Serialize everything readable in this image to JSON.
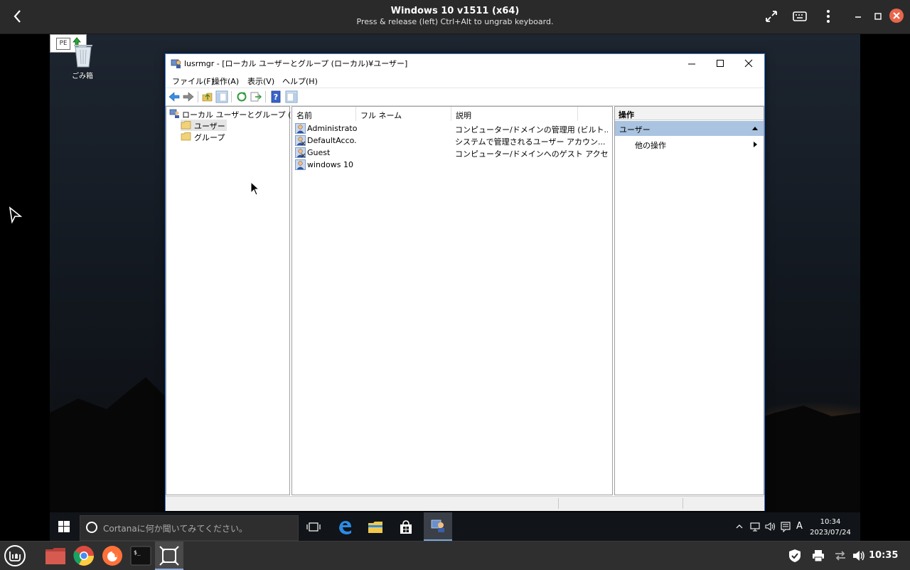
{
  "viewer": {
    "title": "Windows 10 v1511 (x64)",
    "subtitle": "Press & release (left) Ctrl+Alt to ungrab keyboard."
  },
  "desktop": {
    "recycle_bin_label": "ごみ箱",
    "ime_label": "PE"
  },
  "window": {
    "title": "lusrmgr - [ローカル ユーザーとグループ (ローカル)¥ユーザー]",
    "menu": [
      "ファイル(F)",
      "操作(A)",
      "表示(V)",
      "ヘルプ(H)"
    ],
    "tree": {
      "root": "ローカル ユーザーとグループ (ローカル)",
      "children": [
        "ユーザー",
        "グループ"
      ],
      "selected": "ユーザー"
    },
    "columns": [
      "名前",
      "フル ネーム",
      "説明"
    ],
    "users": [
      {
        "name": "Administrator",
        "full_name": "",
        "description": "コンピューター/ドメインの管理用 (ビルト..."
      },
      {
        "name": "DefaultAcco...",
        "full_name": "",
        "description": "システムで管理されるユーザー アカウン..."
      },
      {
        "name": "Guest",
        "full_name": "",
        "description": "コンピューター/ドメインへのゲスト アクセ..."
      },
      {
        "name": "windows 10",
        "full_name": "",
        "description": ""
      }
    ],
    "actions": {
      "header": "操作",
      "section": "ユーザー",
      "item": "他の操作"
    }
  },
  "win_taskbar": {
    "search_placeholder": "Cortanaに何か聞いてみてください。",
    "ime_indicator": "A",
    "time": "10:34",
    "date": "2023/07/24"
  },
  "host_panel": {
    "time": "10:35"
  },
  "colors": {
    "accent": "#3a7bd5",
    "selection": "#a9c3e0",
    "viewer_close": "#e8664c"
  }
}
